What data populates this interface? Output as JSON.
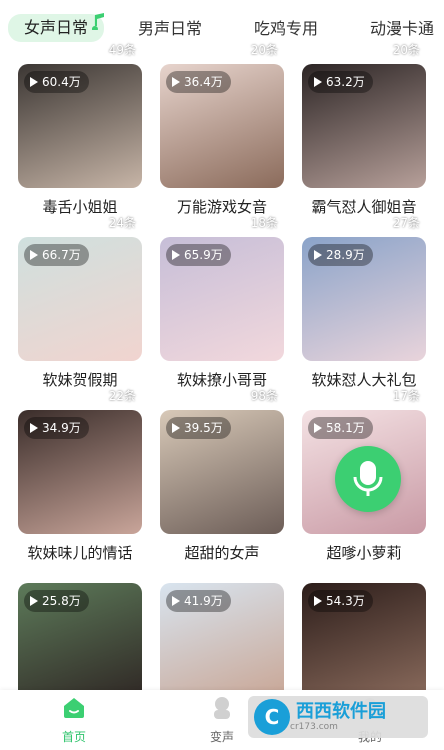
{
  "tabs": [
    {
      "label": "女声日常",
      "active": true
    },
    {
      "label": "男声日常",
      "active": false
    },
    {
      "label": "吃鸡专用",
      "active": false
    },
    {
      "label": "动漫卡通",
      "active": false
    }
  ],
  "cards": [
    {
      "plays": "60.4万",
      "count": "49条",
      "title": "毒舌小姐姐",
      "colors": [
        "#3b3633",
        "#c7b5a7"
      ]
    },
    {
      "plays": "36.4万",
      "count": "20条",
      "title": "万能游戏女音",
      "colors": [
        "#e7d4cd",
        "#8b6b5b"
      ]
    },
    {
      "plays": "63.2万",
      "count": "20条",
      "title": "霸气怼人御姐音",
      "colors": [
        "#2c2525",
        "#b7a09a"
      ]
    },
    {
      "plays": "66.7万",
      "count": "24条",
      "title": "软妹贺假期",
      "colors": [
        "#cfe0de",
        "#f1d4cf"
      ]
    },
    {
      "plays": "65.9万",
      "count": "18条",
      "title": "软妹撩小哥哥",
      "colors": [
        "#c6bed8",
        "#f2d8dc"
      ]
    },
    {
      "plays": "28.9万",
      "count": "27条",
      "title": "软妹怼人大礼包",
      "colors": [
        "#8aa3c9",
        "#e9d4db"
      ]
    },
    {
      "plays": "34.9万",
      "count": "22条",
      "title": "软妹味儿的情话",
      "colors": [
        "#3a2d2a",
        "#c9a59a"
      ]
    },
    {
      "plays": "39.5万",
      "count": "98条",
      "title": "超甜的女声",
      "colors": [
        "#d8c9b8",
        "#6c5d57"
      ]
    },
    {
      "plays": "58.1万",
      "count": "17条",
      "title": "超嗲小萝莉",
      "colors": [
        "#f4e2e4",
        "#c99aa5"
      ]
    },
    {
      "plays": "25.8万",
      "count": "",
      "title": "",
      "colors": [
        "#5d7b5a",
        "#2d2322"
      ]
    },
    {
      "plays": "41.9万",
      "count": "",
      "title": "",
      "colors": [
        "#d8e4ef",
        "#c8a391"
      ]
    },
    {
      "plays": "54.3万",
      "count": "",
      "title": "",
      "colors": [
        "#2c1d1a",
        "#8f6f60"
      ]
    }
  ],
  "bottom_nav": [
    {
      "label": "首页",
      "icon": "home-icon",
      "active": true
    },
    {
      "label": "变声",
      "icon": "voice-change-icon",
      "active": false
    },
    {
      "label": "我的",
      "icon": "profile-icon",
      "active": false
    }
  ],
  "watermark": {
    "brand": "西西软件园",
    "url": "cr173.com"
  },
  "colors": {
    "accent": "#3ccf72",
    "active_tab_bg": "#dff6e6"
  }
}
